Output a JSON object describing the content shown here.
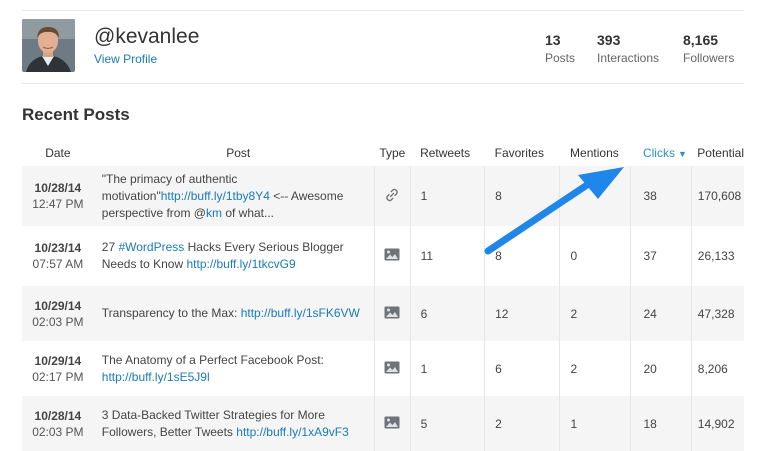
{
  "profile": {
    "handle": "@kevanlee",
    "view_profile": "View Profile",
    "stats": [
      {
        "num": "13",
        "label": "Posts"
      },
      {
        "num": "393",
        "label": "Interactions"
      },
      {
        "num": "8,165",
        "label": "Followers"
      }
    ]
  },
  "section_title": "Recent Posts",
  "columns": {
    "date": "Date",
    "post": "Post",
    "type": "Type",
    "retweets": "Retweets",
    "favorites": "Favorites",
    "mentions": "Mentions",
    "clicks": "Clicks",
    "potential": "Potential"
  },
  "rows": [
    {
      "date": "10/28/14",
      "time": "12:47 PM",
      "type_icon": "link-icon",
      "text_a": "\"The primacy of authentic motivation\"",
      "link_a": "http://buff.ly/1tby8Y4",
      "text_b": " <-- Awesome perspective from @",
      "link_b": "km",
      "text_c": " of what...",
      "retweets": "1",
      "favorites": "8",
      "mentions": "",
      "clicks": "38",
      "potential": "170,608"
    },
    {
      "date": "10/23/14",
      "time": "07:57 AM",
      "type_icon": "image-icon",
      "text_a": "27 ",
      "link_a": "#WordPress",
      "text_b": " Hacks Every Serious Blogger Needs to Know ",
      "link_b": "http://buff.ly/1tkcvG9",
      "text_c": "",
      "retweets": "11",
      "favorites": "8",
      "mentions": "0",
      "clicks": "37",
      "potential": "26,133"
    },
    {
      "date": "10/29/14",
      "time": "02:03 PM",
      "type_icon": "image-icon",
      "text_a": "Transparency to the Max: ",
      "link_a": "http://buff.ly/1sFK6VW",
      "text_b": "",
      "link_b": "",
      "text_c": "",
      "retweets": "6",
      "favorites": "12",
      "mentions": "2",
      "clicks": "24",
      "potential": "47,328"
    },
    {
      "date": "10/29/14",
      "time": "02:17 PM",
      "type_icon": "image-icon",
      "text_a": "The Anatomy of a Perfect Facebook Post: ",
      "link_a": "http://buff.ly/1sE5J9l",
      "text_b": "",
      "link_b": "",
      "text_c": "",
      "retweets": "1",
      "favorites": "6",
      "mentions": "2",
      "clicks": "20",
      "potential": "8,206"
    },
    {
      "date": "10/28/14",
      "time": "02:03 PM",
      "type_icon": "image-icon",
      "text_a": "3 Data-Backed Twitter Strategies for More Followers, Better Tweets ",
      "link_a": "http://buff.ly/1xA9vF3",
      "text_b": "",
      "link_b": "",
      "text_c": "",
      "retweets": "5",
      "favorites": "2",
      "mentions": "1",
      "clicks": "18",
      "potential": "14,902"
    }
  ],
  "colors": {
    "link": "#1b7ab8",
    "accent": "#2a8fd6",
    "arrow": "#1f86ea",
    "row_alt": "#f5f5f5"
  }
}
